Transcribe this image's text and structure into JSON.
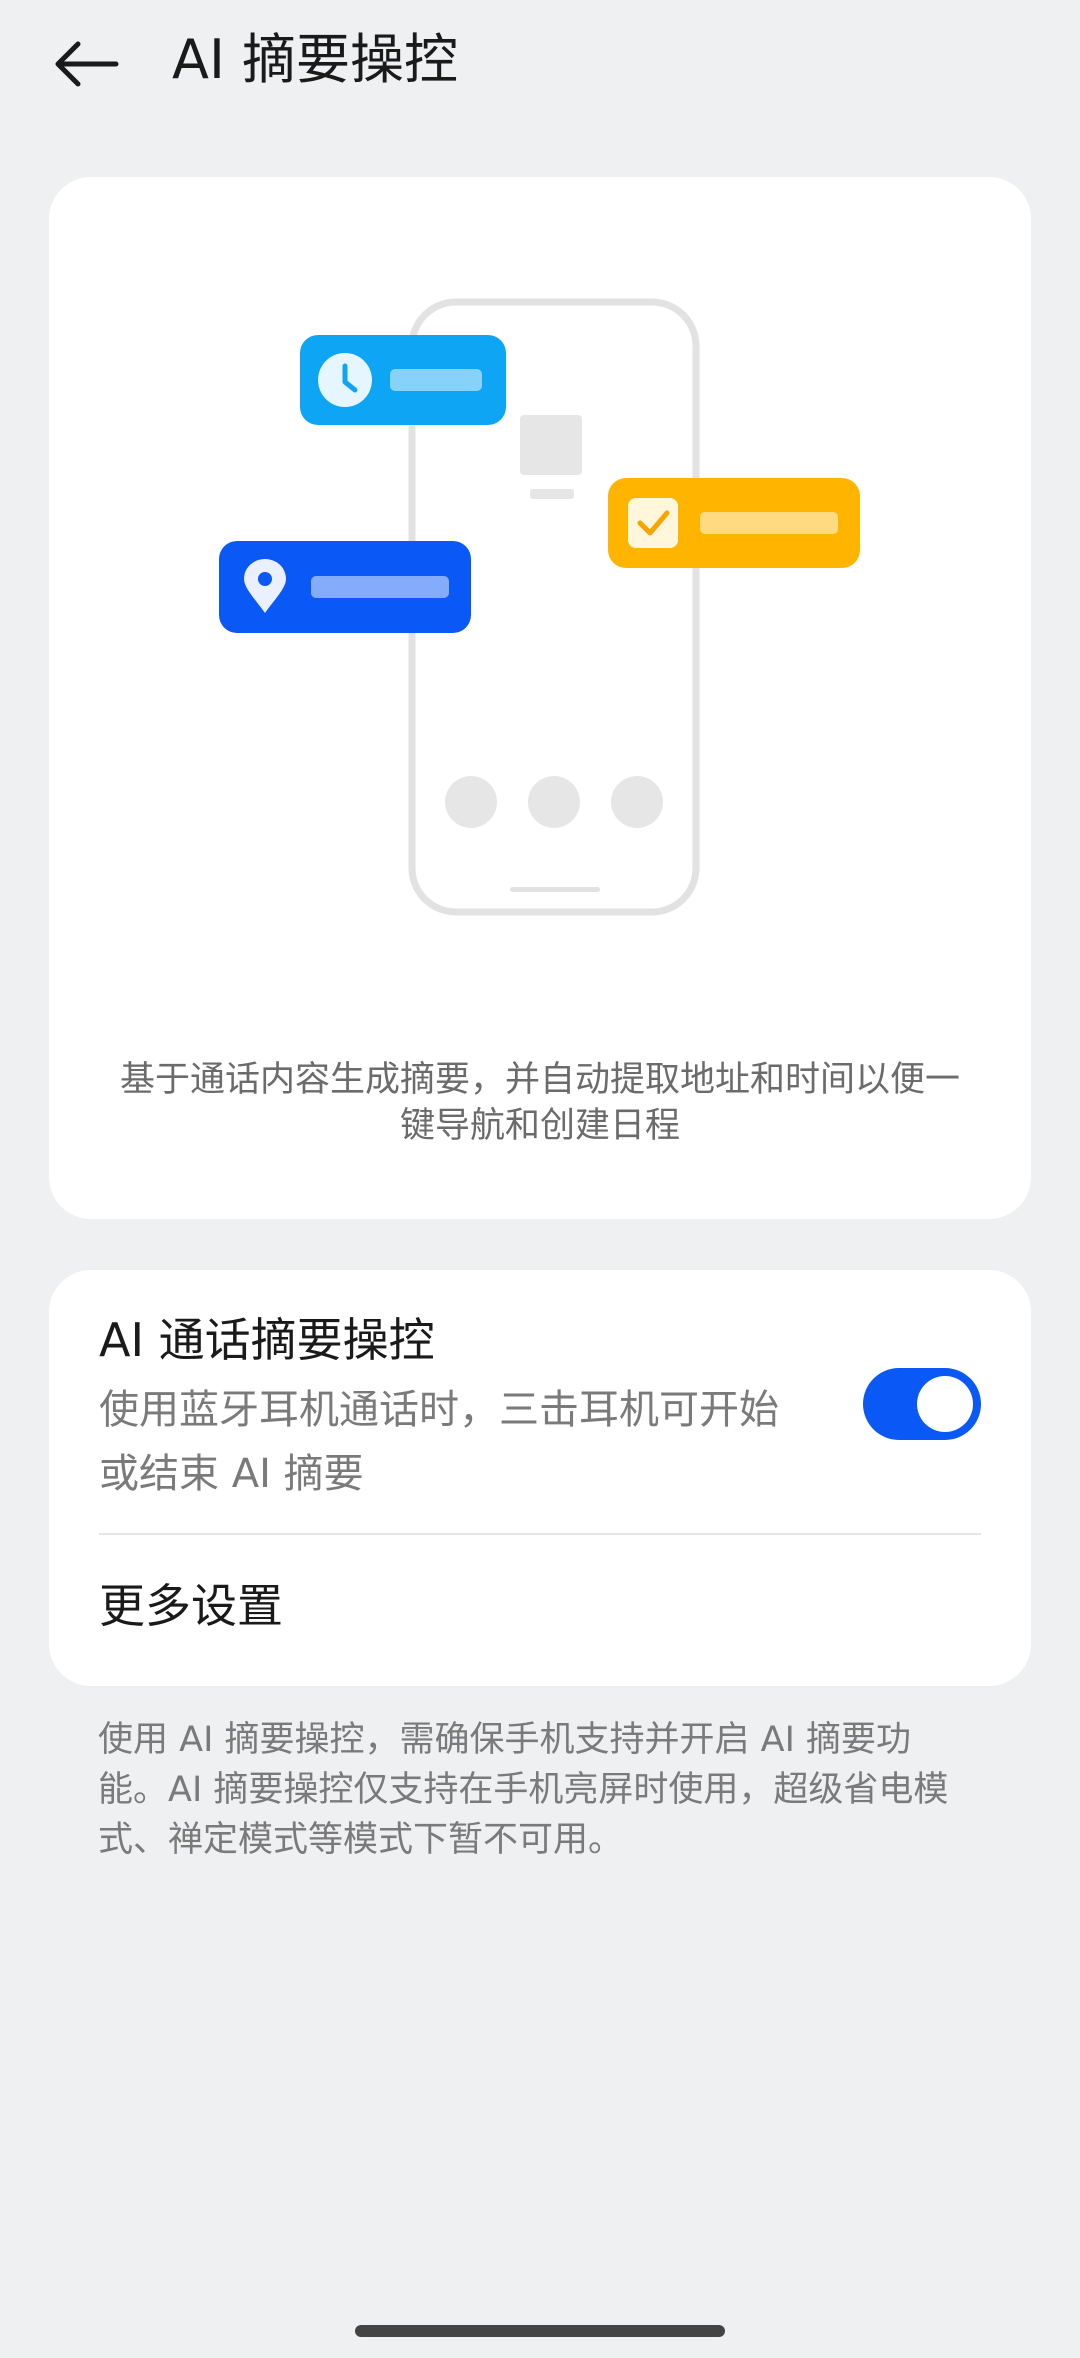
{
  "header": {
    "title": "AI 摘要操控",
    "back_icon": "arrow-left-icon"
  },
  "hero": {
    "description": "基于通话内容生成摘要，并自动提取地址和时间以便一键导航和创建日程",
    "illustration_icons": [
      "clock-icon",
      "check-icon",
      "location-pin-icon"
    ],
    "colors": {
      "clock_chip": "#0ea5f5",
      "check_chip": "#ffb400",
      "location_chip": "#0a59f7"
    }
  },
  "settings": {
    "ai_control": {
      "title": "AI 通话摘要操控",
      "description": "使用蓝牙耳机通话时，三击耳机可开始或结束 AI 摘要",
      "enabled": true
    },
    "more": {
      "label": "更多设置"
    }
  },
  "footnote": "使用 AI 摘要操控，需确保手机支持并开启 AI 摘要功能。AI 摘要操控仅支持在手机亮屏时使用，超级省电模式、禅定模式等模式下暂不可用。",
  "theme": {
    "accent": "#0a59f7",
    "background": "#eff0f2",
    "card": "#ffffff"
  }
}
